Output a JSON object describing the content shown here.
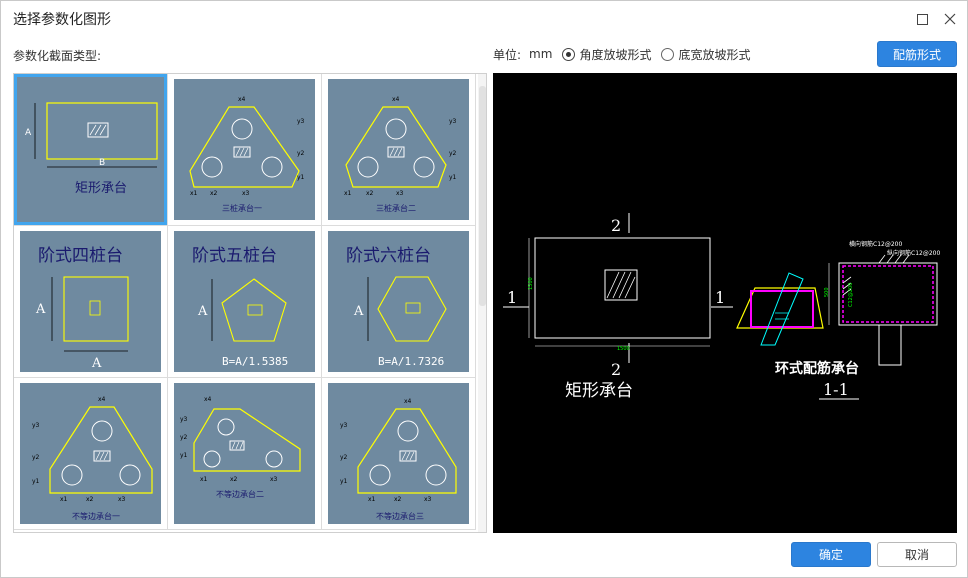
{
  "dialog": {
    "title": "选择参数化图形",
    "section_label": "参数化截面类型:"
  },
  "options": {
    "unit_label": "单位:",
    "unit_value": "mm",
    "radio_angle": "角度放坡形式",
    "radio_bottom": "底宽放坡形式",
    "selected": "angle",
    "rebar_button": "配筋形式"
  },
  "gallery": {
    "items": [
      {
        "id": "rect",
        "caption": "矩形承台",
        "dims": [
          "A",
          "B"
        ]
      },
      {
        "id": "tri1",
        "caption": "三桩承台一",
        "dims": [
          "x1",
          "x2",
          "x3",
          "x4",
          "y1",
          "y2",
          "y3"
        ]
      },
      {
        "id": "tri2",
        "caption": "三桩承台二",
        "dims": [
          "x1",
          "x2",
          "x3",
          "x4",
          "y1",
          "y2",
          "y3"
        ]
      },
      {
        "id": "step4",
        "caption": "阶式四桩台",
        "dims": [
          "A",
          "A"
        ]
      },
      {
        "id": "step5",
        "caption": "阶式五桩台",
        "dims": [
          "A"
        ],
        "formula": "B=A/1.5385"
      },
      {
        "id": "step6",
        "caption": "阶式六桩台",
        "dims": [
          "A"
        ],
        "formula": "B=A/1.7326"
      },
      {
        "id": "uneq1",
        "caption": "不等边承台一",
        "dims": [
          "x1",
          "x2",
          "x3",
          "x4",
          "y1",
          "y2",
          "y3"
        ]
      },
      {
        "id": "uneq2",
        "caption": "不等边承台二",
        "dims": [
          "x1",
          "x2",
          "x3",
          "x4",
          "y1",
          "y2",
          "y3"
        ]
      },
      {
        "id": "uneq3",
        "caption": "不等边承台三",
        "dims": [
          "x1",
          "x2",
          "x3",
          "x4",
          "y1",
          "y2",
          "y3"
        ]
      }
    ]
  },
  "preview": {
    "section_mark": "2",
    "side_mark": "1",
    "dim_width": "1500",
    "dim_height": "1500",
    "shape_label": "矩形承台",
    "ring_label": "环式配筋承台",
    "section_label": "1-1",
    "rebar_h": "横向钢筋C12@200",
    "rebar_v": "纵向钢筋C12@200",
    "rebar_side": "C12@200",
    "dim_side": "500"
  },
  "footer": {
    "ok": "确定",
    "cancel": "取消"
  },
  "colors": {
    "accent": "#2d84e0",
    "thumb_bg": "#6f8aa0",
    "cad_yellow": "#ffff00",
    "cad_magenta": "#ff00ff",
    "cad_cyan": "#00ffff",
    "cad_green": "#00ff00"
  }
}
